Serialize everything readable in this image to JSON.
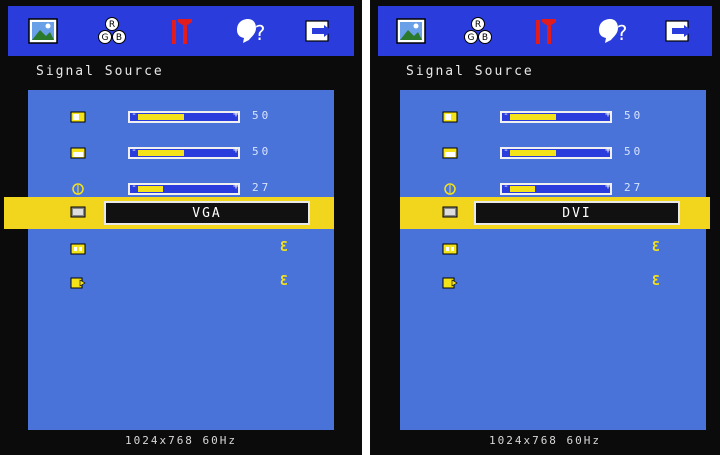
{
  "screens": [
    {
      "title": "Signal Source",
      "menu_icons": [
        "picture-icon",
        "rgb-icon",
        "tools-icon",
        "help-icon",
        "exit-icon"
      ],
      "rows": [
        {
          "icon": "h-position-icon",
          "level": 0.5,
          "value": "50"
        },
        {
          "icon": "v-position-icon",
          "level": 0.5,
          "value": "50"
        },
        {
          "icon": "phase-icon",
          "level": 0.27,
          "value": "27"
        }
      ],
      "selected": {
        "icon": "input-icon",
        "value": "VGA"
      },
      "extra": [
        {
          "icon": "input-select-icon",
          "mark": "Ɛ"
        },
        {
          "icon": "exit-menu-icon",
          "mark": "Ɛ"
        }
      ],
      "footer": "1024x768   60Hz"
    },
    {
      "title": "Signal Source",
      "menu_icons": [
        "picture-icon",
        "rgb-icon",
        "tools-icon",
        "help-icon",
        "exit-icon"
      ],
      "rows": [
        {
          "icon": "h-position-icon",
          "level": 0.5,
          "value": "50"
        },
        {
          "icon": "v-position-icon",
          "level": 0.5,
          "value": "50"
        },
        {
          "icon": "phase-icon",
          "level": 0.27,
          "value": "27"
        }
      ],
      "selected": {
        "icon": "input-icon",
        "value": "DVI"
      },
      "extra": [
        {
          "icon": "input-select-icon",
          "mark": "Ɛ"
        },
        {
          "icon": "exit-menu-icon",
          "mark": "Ɛ"
        }
      ],
      "footer": "1024x768   60Hz"
    }
  ],
  "colors": {
    "menu_bar": "#2a3ddc",
    "panel": "#4a73da",
    "highlight": "#f2d51d",
    "fill": "#f5e31a"
  }
}
